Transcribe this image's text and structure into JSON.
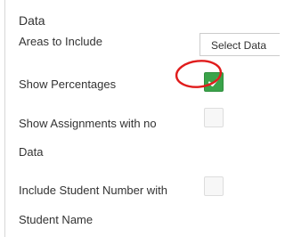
{
  "section": {
    "title": "Data"
  },
  "rows": {
    "areas_to_include": {
      "label": "Areas to Include",
      "button_label": "Select Data"
    },
    "show_percentages": {
      "label": "Show Percentages",
      "checked": true
    },
    "show_assignments_no_data": {
      "label_line1": "Show Assignments with no",
      "label_line2": "Data",
      "checked": false
    },
    "include_student_number": {
      "label_line1": "Include Student Number with",
      "label_line2": "Student Name",
      "checked": false
    }
  },
  "colors": {
    "checked_fill": "#3aa34a",
    "annotation_circle": "#e01c1c"
  },
  "icons": {
    "checkmark": "check-icon"
  }
}
